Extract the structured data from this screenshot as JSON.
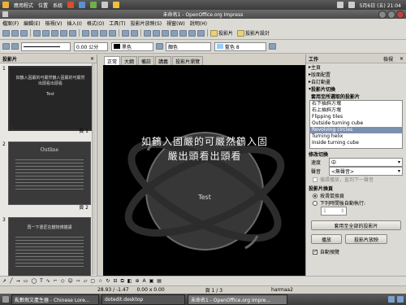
{
  "top_panel": {
    "menus": [
      "應用程式",
      "位置",
      "系統"
    ],
    "clock": "5月6日 (五) 21:04",
    "user": "harmaa2"
  },
  "window": {
    "title": "未命名1 - OpenOffice.org Impress"
  },
  "menubar": {
    "items": [
      "檔案(F)",
      "編輯(E)",
      "檢視(V)",
      "插入(I)",
      "格式(O)",
      "工具(T)",
      "投影片放映(S)",
      "視窗(W)",
      "說明(H)"
    ]
  },
  "toolbar": {
    "slide_button": "投影片",
    "slide_design_button": "投影片設計"
  },
  "line_toolbar": {
    "line_width": "0.00 公分",
    "color_name": "黑色",
    "fill_color_name": "藍色 8"
  },
  "slides_pane": {
    "title": "投影片",
    "slides": [
      {
        "number": "1",
        "page_label": "頁 1",
        "title": "如鶴入固嚴的可嚴然鶴入固嚴的可嚴然出頭看出頭看",
        "subtitle": "Test"
      },
      {
        "number": "2",
        "page_label": "頁 2",
        "title": "Outline"
      },
      {
        "number": "3",
        "page_label": "頁 3",
        "title": "再一下書匠在鍵物博體講"
      }
    ]
  },
  "view_tabs": [
    "正常",
    "大綱",
    "備註",
    "講義",
    "投影片瀏覽"
  ],
  "slide_canvas": {
    "title_text": "如鶴入固嚴的可嚴然鶴入固嚴出頭看出頭看",
    "subtitle_text": "Test"
  },
  "task_pane": {
    "header": "工作",
    "view_label": "檢視",
    "sections": [
      "主頁",
      "版面配置",
      "自訂動畫",
      "投影片切換"
    ],
    "apply_label": "套用至所選取的投影片",
    "transitions": [
      "右下插斜方塊",
      "右上插斜方塊",
      "Flipping tiles",
      "Outside turning cube",
      "Revolving circles",
      "Turning helix",
      "Inside turning cube"
    ],
    "selected_transition": "Revolving circles",
    "modify_label": "修改切換",
    "speed_label": "速度",
    "speed_value": "中",
    "sound_label": "聲音",
    "sound_value": "<無聲音>",
    "loop_label": "循環播放，直到下一聲音",
    "advance_label": "投影片換頁",
    "on_click_label": "按滑鼠換頁",
    "auto_label": "下列時間後自動執行:",
    "auto_value": "1",
    "apply_all_button": "套用至全部的投影片",
    "play_button": "播放",
    "slideshow_button": "投影片放映",
    "preview_label": "自動預覽"
  },
  "statusbar": {
    "position": "28.93 / -1.47",
    "size": "0.00 x 0.00",
    "page": "頁 1 / 3",
    "zoom": "",
    "user": "harmaa2"
  },
  "taskbar": {
    "tasks": [
      "亂數假文產生器 - Chinese Lore...",
      "dotedit.desktop",
      "未命名1 - OpenOffice.org Impre..."
    ]
  },
  "colors": {
    "panel": "#4a4a4a",
    "slide_bg": "#000000",
    "selection": "#7b8fb0",
    "line_color": "#000000",
    "fill_color": "#99ccff"
  }
}
